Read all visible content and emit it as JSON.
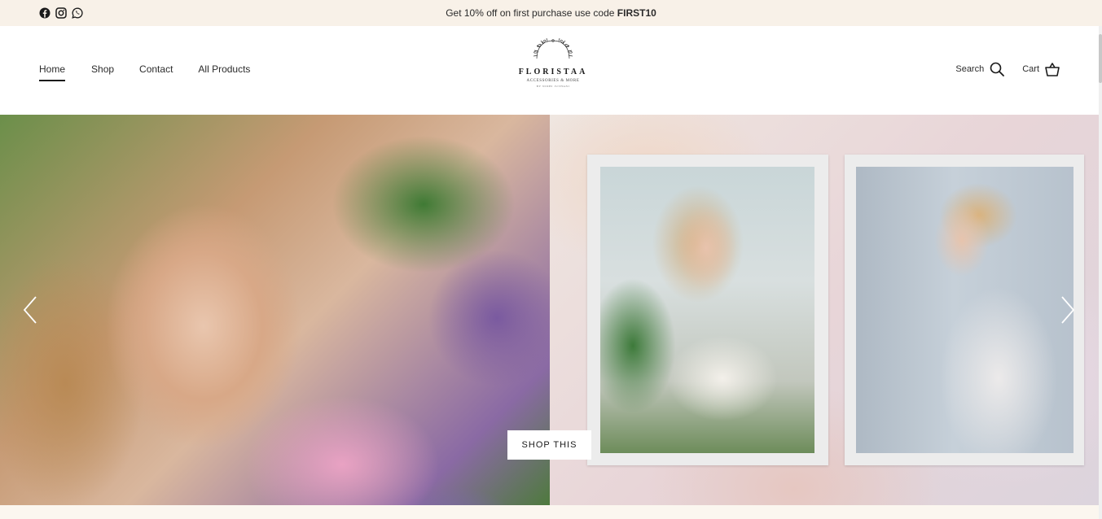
{
  "announcement": {
    "text_prefix": "Get 10% off on first purchase use code ",
    "code": "FIRST10",
    "social_icons": [
      "facebook-icon",
      "instagram-icon",
      "whatsapp-icon"
    ]
  },
  "nav": {
    "items": [
      {
        "label": "Home",
        "active": true
      },
      {
        "label": "Shop",
        "active": false
      },
      {
        "label": "Contact",
        "active": false
      },
      {
        "label": "All Products",
        "active": false
      }
    ]
  },
  "logo": {
    "brand": "FLORISTAA",
    "tagline": "ACCESSORIES & MORE",
    "subtagline": "BY NIDHI JUTHANI"
  },
  "header_actions": {
    "search_label": "Search",
    "cart_label": "Cart"
  },
  "hero": {
    "cta_label": "SHOP THIS",
    "prev_icon": "chevron-left-icon",
    "next_icon": "chevron-right-icon"
  },
  "colors": {
    "announcement_bg": "#f8f1e8",
    "text": "#1a1a1a",
    "cta_bg": "#ffffff"
  }
}
